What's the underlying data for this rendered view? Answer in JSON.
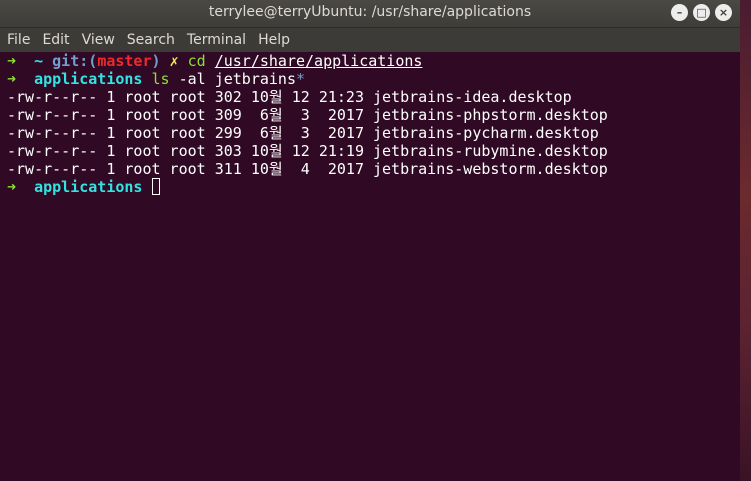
{
  "window": {
    "title": "terrylee@terryUbuntu: /usr/share/applications",
    "buttons": {
      "minimize": "–",
      "maximize": "□",
      "close": "×"
    }
  },
  "menu": [
    "File",
    "Edit",
    "View",
    "Search",
    "Terminal",
    "Help"
  ],
  "terminal": {
    "prompt_arrow": "➜",
    "line1": {
      "dir": "~",
      "git_open": "git:(",
      "branch": "master",
      "git_close": ")",
      "dirty_mark": "✗",
      "command": "cd",
      "argument": "/usr/share/applications"
    },
    "line2": {
      "dir": "applications",
      "command": "ls",
      "args": "-al jetbrains",
      "glob": "*"
    },
    "listing": [
      "-rw-r--r-- 1 root root 302 10월 12 21:23 jetbrains-idea.desktop",
      "-rw-r--r-- 1 root root 309  6월  3  2017 jetbrains-phpstorm.desktop",
      "-rw-r--r-- 1 root root 299  6월  3  2017 jetbrains-pycharm.desktop",
      "-rw-r--r-- 1 root root 303 10월 12 21:19 jetbrains-rubymine.desktop",
      "-rw-r--r-- 1 root root 311 10월  4  2017 jetbrains-webstorm.desktop"
    ],
    "line3": {
      "dir": "applications"
    }
  },
  "colors": {
    "background": "#300a24",
    "prompt_arrow": "#8ae234",
    "dir": "#34e2e2",
    "branch": "#ef2929",
    "dirty": "#fce94f"
  }
}
